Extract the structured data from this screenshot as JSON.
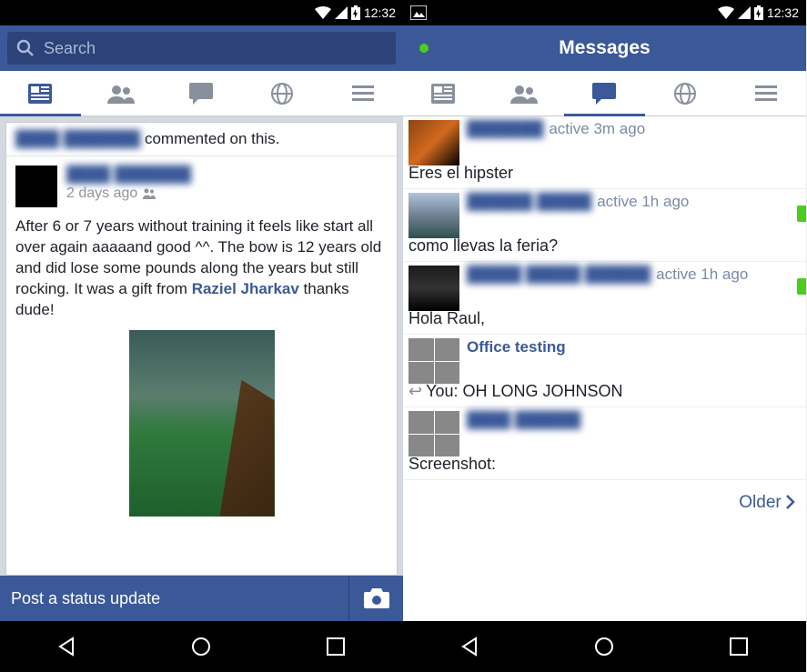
{
  "status": {
    "time": "12:32"
  },
  "left": {
    "search_placeholder": "Search",
    "activity": {
      "actor": "████ ███████",
      "action": "commented on this."
    },
    "post": {
      "author": "████ ███████",
      "time": "2 days ago",
      "body_pre": "After 6 or 7 years without training it feels like start all over again aaaaand good ^^. The bow is 12 years old and did lose some pounds along the years but still rocking. It was a gift from ",
      "link": "Raziel Jharkav",
      "body_post": " thanks dude!"
    },
    "compose": "Post a status update"
  },
  "right": {
    "title": "Messages",
    "threads": [
      {
        "name": "███████",
        "status": "active 3m ago",
        "preview": "Eres el hipster",
        "mobile": false
      },
      {
        "name": "██████ █████",
        "status": "active 1h ago",
        "preview": "como llevas la feria?",
        "mobile": true
      },
      {
        "name": "█████ █████ ██████",
        "status": "active 1h ago",
        "preview": "Hola Raul,",
        "mobile": true
      },
      {
        "name": "Office testing",
        "status": "",
        "preview": "You: OH LONG JOHNSON",
        "reply": true,
        "group": true
      },
      {
        "name": "████ ██████",
        "status": "",
        "preview": "Screenshot:",
        "group": true
      }
    ],
    "older": "Older"
  }
}
